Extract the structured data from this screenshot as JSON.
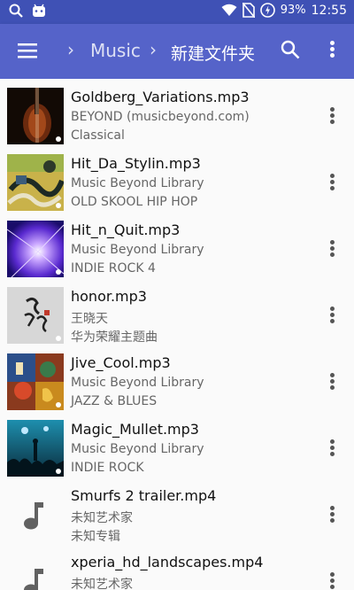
{
  "status_bar": {
    "battery": "93%",
    "time": "12:55"
  },
  "toolbar": {
    "breadcrumb": [
      "Music",
      "新建文件夹"
    ]
  },
  "tracks": [
    {
      "title": "Goldberg_Variations.mp3",
      "artist": "BEYOND (musicbeyond.com)",
      "album": "Classical",
      "art": "violin"
    },
    {
      "title": "Hit_Da_Stylin.mp3",
      "artist": "Music Beyond Library",
      "album": "OLD SKOOL HIP HOP",
      "art": "graffiti"
    },
    {
      "title": "Hit_n_Quit.mp3",
      "artist": "Music Beyond Library",
      "album": "INDIE ROCK 4",
      "art": "light-burst"
    },
    {
      "title": "honor.mp3",
      "artist": "王晓天",
      "album": "华为荣耀主题曲",
      "art": "calligraphy"
    },
    {
      "title": "Jive_Cool.mp3",
      "artist": "Music Beyond Library",
      "album": "JAZZ & BLUES",
      "art": "jazz-painting"
    },
    {
      "title": "Magic_Mullet.mp3",
      "artist": "Music Beyond Library",
      "album": "INDIE ROCK",
      "art": "concert"
    },
    {
      "title": "Smurfs 2 trailer.mp4",
      "artist": "未知艺术家",
      "album": "未知专辑",
      "art": "music-note-icon"
    },
    {
      "title": "xperia_hd_landscapes.mp4",
      "artist": "未知艺术家",
      "album": "",
      "art": "music-note-icon"
    }
  ]
}
